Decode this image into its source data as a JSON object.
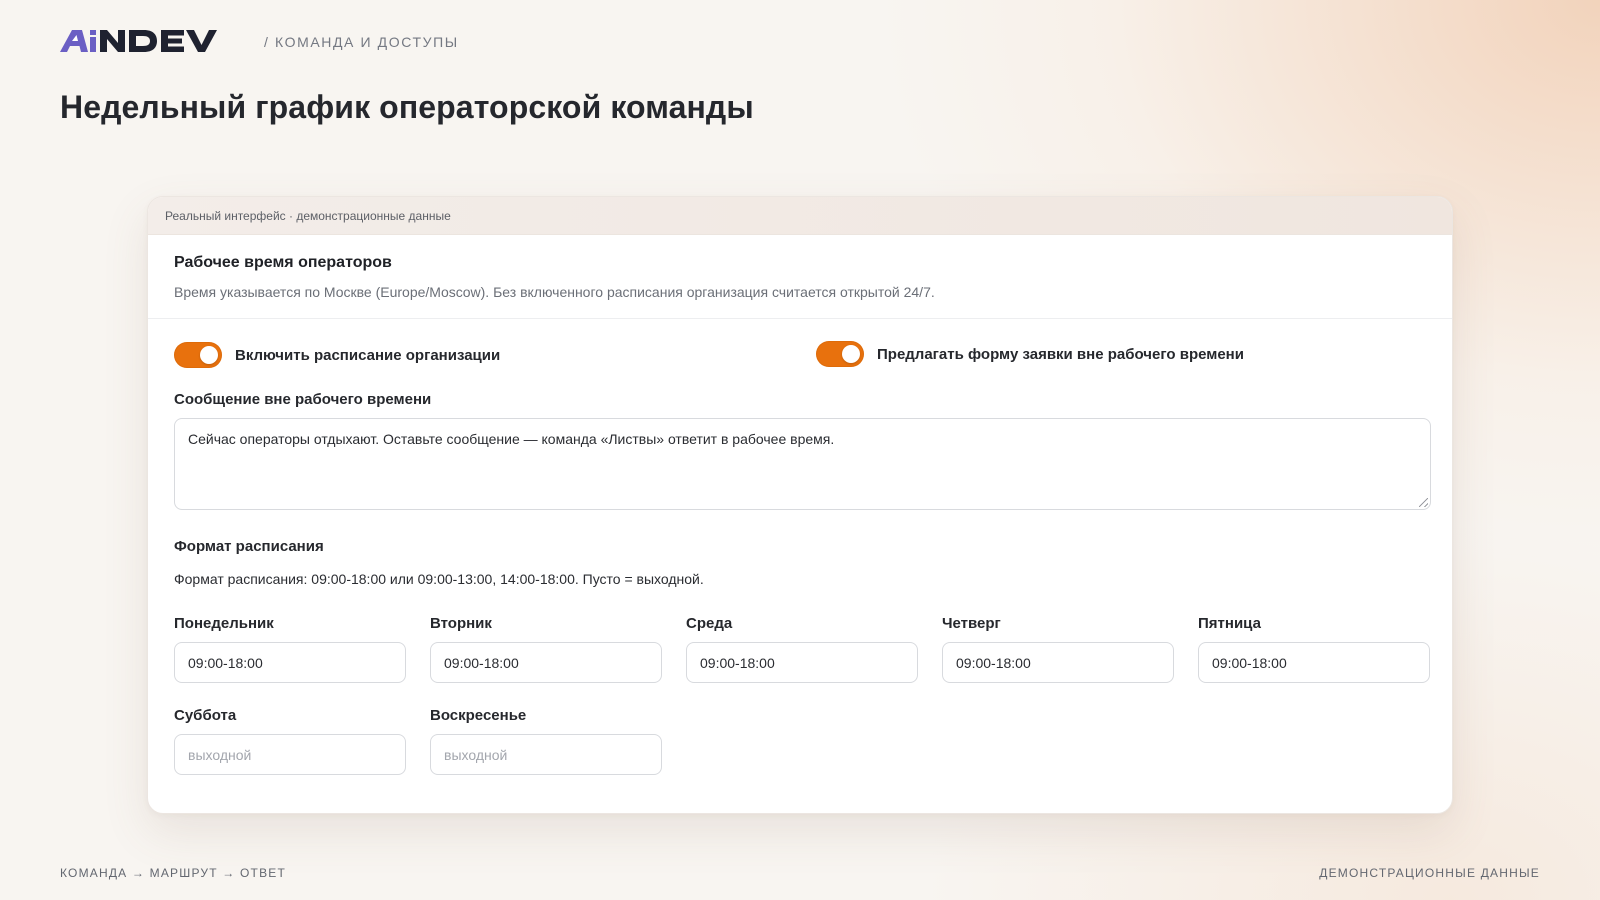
{
  "header": {
    "logo_text": "AiNDEV",
    "breadcrumb": "/ КОМАНДА И ДОСТУПЫ"
  },
  "page": {
    "title": "Недельный график операторской команды"
  },
  "card": {
    "strip_text": "Реальный интерфейс · демонстрационные данные",
    "section_title": "Рабочее время операторов",
    "section_subtitle": "Время указывается по Москве (Europe/Moscow). Без включенного расписания организация считается открытой 24/7.",
    "toggles": [
      {
        "label": "Включить расписание организации",
        "on": true
      },
      {
        "label": "Предлагать форму заявки вне рабочего времени",
        "on": true
      }
    ],
    "offhours_message_label": "Сообщение вне рабочего времени",
    "offhours_message_value": "Сейчас операторы отдыхают. Оставьте сообщение — команда «Листвы» ответит в рабочее время.",
    "format_label": "Формат расписания",
    "format_hint": "Формат расписания: 09:00-18:00 или 09:00-13:00, 14:00-18:00. Пусто = выходной.",
    "days": [
      {
        "label": "Понедельник",
        "value": "09:00-18:00",
        "placeholder": ""
      },
      {
        "label": "Вторник",
        "value": "09:00-18:00",
        "placeholder": ""
      },
      {
        "label": "Среда",
        "value": "09:00-18:00",
        "placeholder": ""
      },
      {
        "label": "Четверг",
        "value": "09:00-18:00",
        "placeholder": ""
      },
      {
        "label": "Пятница",
        "value": "09:00-18:00",
        "placeholder": ""
      },
      {
        "label": "Суббота",
        "value": "",
        "placeholder": "выходной"
      },
      {
        "label": "Воскресенье",
        "value": "",
        "placeholder": "выходной"
      }
    ]
  },
  "footer": {
    "left": "КОМАНДА → МАРШРУТ → ОТВЕТ",
    "right": "ДЕМОНСТРАЦИОННЫЕ ДАННЫЕ"
  },
  "colors": {
    "accent": "#e8710d",
    "logo_a": "#6b5fc4",
    "logo_text": "#1f2230"
  }
}
